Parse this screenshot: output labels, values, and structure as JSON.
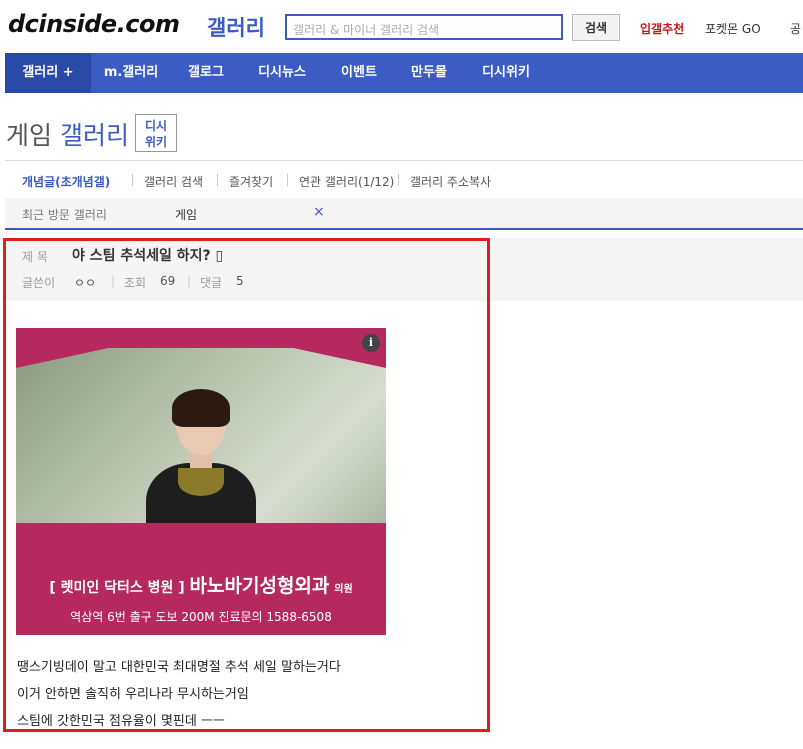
{
  "header": {
    "logo": "dcinside.com",
    "logo_sub": "갤러리",
    "search_placeholder": "갤러리 & 마이너 갤러리 검색",
    "search_button": "검색",
    "links": [
      "입갤추천",
      "포켓몬 GO",
      "공"
    ]
  },
  "nav": {
    "items": [
      "갤러리 +",
      "m.갤러리",
      "갤로그",
      "디시뉴스",
      "이벤트",
      "만두몰",
      "디시위키"
    ]
  },
  "gallery": {
    "title_prefix": "게임",
    "title_suffix": "갤러리",
    "wiki_line1": "디시",
    "wiki_line2": "위키"
  },
  "tabs": [
    "개념글(초개념갤)",
    "갤러리 검색",
    "즐겨찾기",
    "연관 갤러리(1/12)",
    "갤러리 주소복사"
  ],
  "recent": {
    "label": "최근 방문 갤러리",
    "value": "게임",
    "close": "×"
  },
  "post": {
    "title_label": "제 목",
    "title": "야 스팀 추석세일 하지? ▯",
    "author_label": "글쓴이",
    "author": "ㅇㅇ",
    "views_label": "조회",
    "views": "69",
    "comments_label": "댓글",
    "comments": "5",
    "body": [
      "땡스기빙데이 말고 대한민국 최대명절 추석 세일 말하는거다",
      "이거 안하면 솔직히 우리나라 무시하는거임",
      "스팀에 갓한민국 점유율이 몇핀데 ㅡㅡ"
    ]
  },
  "ad": {
    "info": "i",
    "line1_small": "[ 렛미인 닥터스 병원 ]",
    "line1_big": "바노바기성형외과",
    "line1_tail": "의원",
    "line2": "역삼역 6번 출구 도보 200M 진료문의 1588-6508"
  },
  "colors": {
    "brand": "#3b5cc4",
    "highlight": "#e21b1b",
    "ad_bg": "#b5295f"
  }
}
